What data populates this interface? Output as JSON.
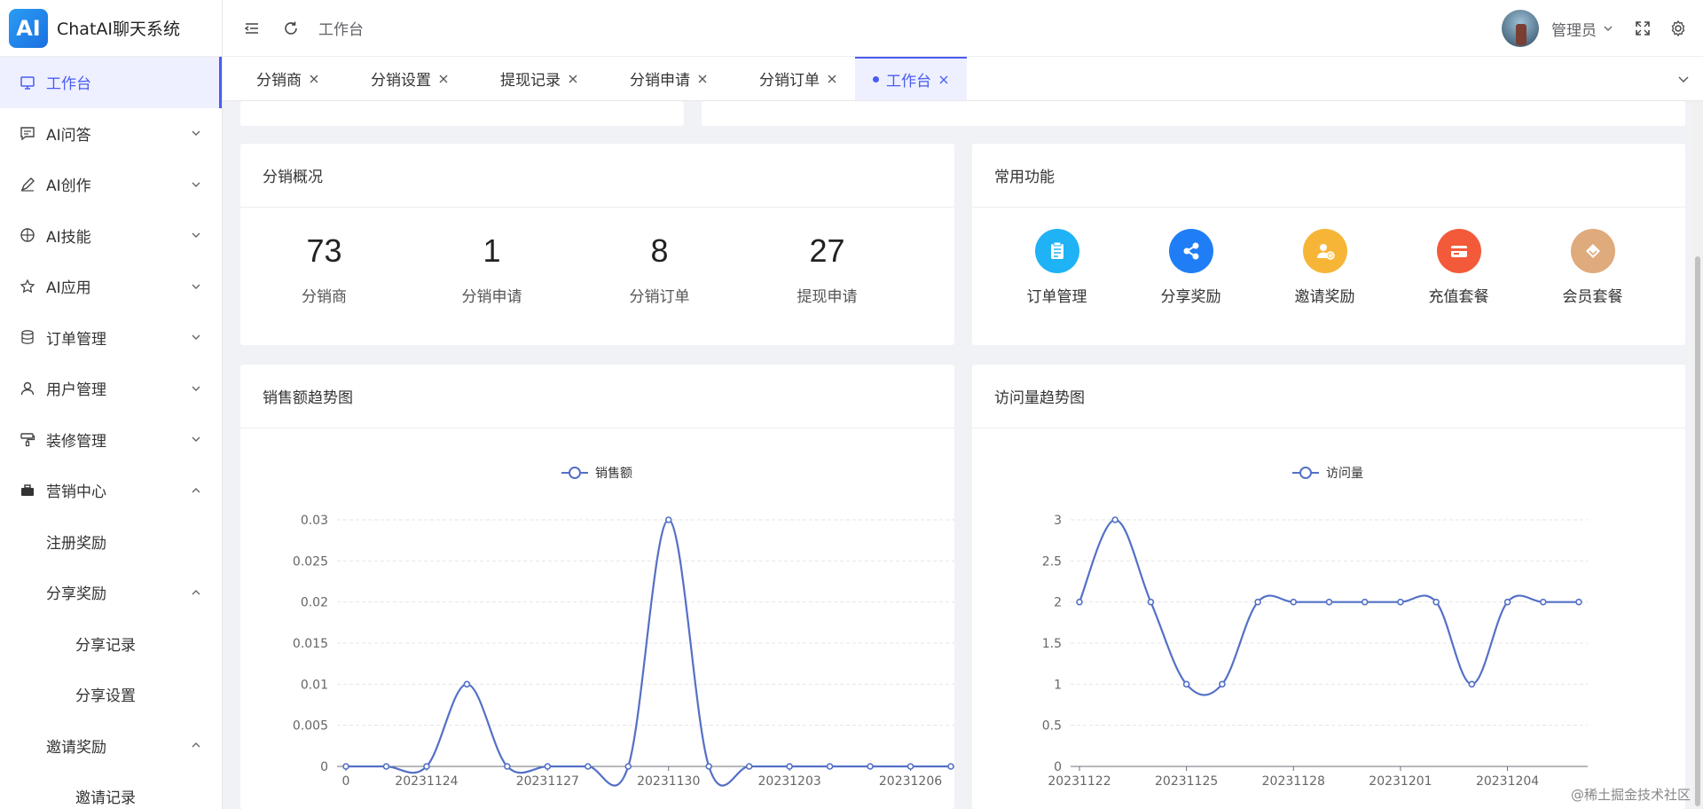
{
  "app": {
    "logo_badge": "AI",
    "title": "ChatAI聊天系统"
  },
  "header": {
    "breadcrumb": "工作台",
    "username": "管理员"
  },
  "sidebar": {
    "items": [
      {
        "label": "工作台"
      },
      {
        "label": "AI问答"
      },
      {
        "label": "AI创作"
      },
      {
        "label": "AI技能"
      },
      {
        "label": "AI应用"
      },
      {
        "label": "订单管理"
      },
      {
        "label": "用户管理"
      },
      {
        "label": "装修管理"
      },
      {
        "label": "营销中心"
      },
      {
        "label": "注册奖励"
      },
      {
        "label": "分享奖励"
      },
      {
        "label": "分享记录"
      },
      {
        "label": "分享设置"
      },
      {
        "label": "邀请奖励"
      },
      {
        "label": "邀请记录"
      }
    ]
  },
  "tabs": [
    {
      "label": "分销商"
    },
    {
      "label": "分销设置"
    },
    {
      "label": "提现记录"
    },
    {
      "label": "分销申请"
    },
    {
      "label": "分销订单"
    },
    {
      "label": "工作台"
    }
  ],
  "overview": {
    "title": "分销概况",
    "stats": [
      {
        "value": "73",
        "label": "分销商"
      },
      {
        "value": "1",
        "label": "分销申请"
      },
      {
        "value": "8",
        "label": "分销订单"
      },
      {
        "value": "27",
        "label": "提现申请"
      }
    ]
  },
  "functions": {
    "title": "常用功能",
    "items": [
      {
        "label": "订单管理",
        "icon": "clipboard-icon",
        "color": "#1fb2f5"
      },
      {
        "label": "分享奖励",
        "icon": "share-icon",
        "color": "#1f7ef5"
      },
      {
        "label": "邀请奖励",
        "icon": "invite-user-icon",
        "color": "#f7b538"
      },
      {
        "label": "充值套餐",
        "icon": "card-icon",
        "color": "#f25a3a"
      },
      {
        "label": "会员套餐",
        "icon": "diamond-icon",
        "color": "#dfaa7c"
      }
    ]
  },
  "sales_chart": {
    "title": "销售额趋势图"
  },
  "visits_chart": {
    "title": "访问量趋势图"
  },
  "watermark": "@稀土掘金技术社区",
  "accent_color": "#4a5cf0",
  "line_color": "#5470c6",
  "chart_data": [
    {
      "type": "line",
      "title": "销售额趋势图",
      "legend": [
        "销售额"
      ],
      "x": [
        "0",
        "20231123",
        "20231124",
        "20231125",
        "20231126",
        "20231127",
        "20231128",
        "20231129",
        "20231130",
        "20231201",
        "20231202",
        "20231203",
        "20231204",
        "20231205",
        "20231206"
      ],
      "x_tick_labels": [
        "0",
        "20231124",
        "20231127",
        "20231130",
        "20231203",
        "20231206"
      ],
      "series": [
        {
          "name": "销售额",
          "values": [
            0,
            0,
            0,
            0.01,
            0,
            0,
            0,
            0,
            0.03,
            0,
            0,
            0,
            0,
            0,
            0,
            0
          ]
        }
      ],
      "ylim": [
        0,
        0.03
      ],
      "y_ticks": [
        "0",
        "0.005",
        "0.01",
        "0.015",
        "0.02",
        "0.025",
        "0.03"
      ],
      "smooth": true
    },
    {
      "type": "line",
      "title": "访问量趋势图",
      "legend": [
        "访问量"
      ],
      "x": [
        "20231122",
        "20231123",
        "20231124",
        "20231125",
        "20231126",
        "20231127",
        "20231128",
        "20231129",
        "20231130",
        "20231201",
        "20231202",
        "20231203",
        "20231204",
        "20231205",
        "20231206"
      ],
      "x_tick_labels": [
        "20231122",
        "20231125",
        "20231128",
        "20231201",
        "20231204"
      ],
      "series": [
        {
          "name": "访问量",
          "values": [
            2,
            3,
            2,
            1,
            1,
            2,
            2,
            2,
            2,
            2,
            2,
            1,
            2,
            2,
            2
          ]
        }
      ],
      "ylim": [
        0,
        3
      ],
      "y_ticks": [
        "0",
        "0.5",
        "1",
        "1.5",
        "2",
        "2.5",
        "3"
      ],
      "smooth": true
    }
  ]
}
